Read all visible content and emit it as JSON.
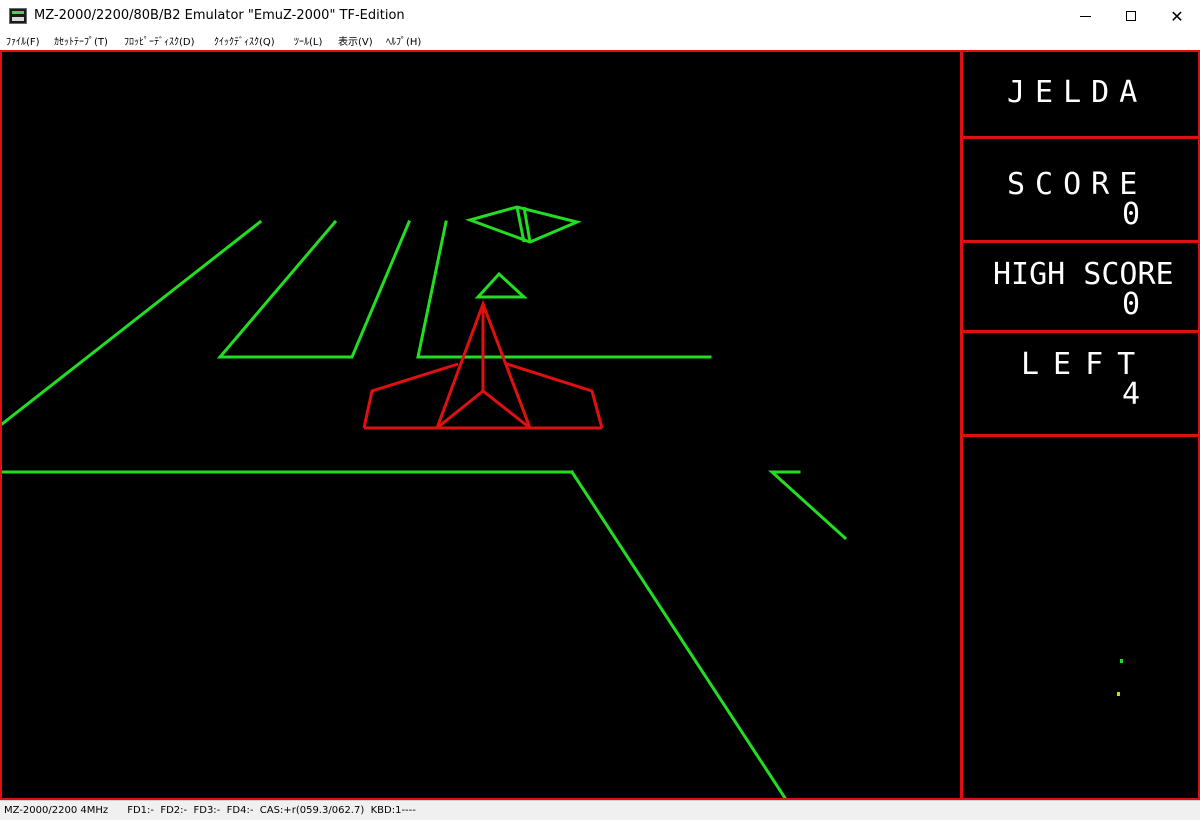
{
  "window": {
    "title": "MZ-2000/2200/80B/B2 Emulator \"EmuZ-2000\" TF-Edition"
  },
  "menu": [
    {
      "label": "ﾌｧｲﾙ(F)"
    },
    {
      "label": "ｶｾｯﾄﾃｰﾌﾟ(T)"
    },
    {
      "label": "ﾌﾛｯﾋﾟｰﾃﾞｨｽｸ(D)"
    },
    {
      "label": "ｸｲｯｸﾃﾞｨｽｸ(Q)"
    },
    {
      "label": "ﾂｰﾙ(L)"
    },
    {
      "label": "表示(V)"
    },
    {
      "label": "ﾍﾙﾌﾟ(H)"
    }
  ],
  "hud": {
    "game_title": "JELDA",
    "score_label": "SCORE",
    "score_value": "0",
    "high_score_label": "HIGH SCORE",
    "high_score_value": "0",
    "left_label": "LEFT",
    "left_value": "4"
  },
  "status": {
    "text": "MZ-2000/2200 4MHz      FD1:-  FD2:-  FD3:-  FD4:-  CAS:+r(059.3/062.7)  KBD:1----"
  },
  "colors": {
    "frame": "#e01010",
    "vector_green": "#22dd22",
    "vector_red": "#e01010",
    "screen_bg": "#000000",
    "hud_text": "#ffffff"
  },
  "icons": [
    "app-icon",
    "minimize-icon",
    "maximize-icon",
    "close-icon"
  ]
}
